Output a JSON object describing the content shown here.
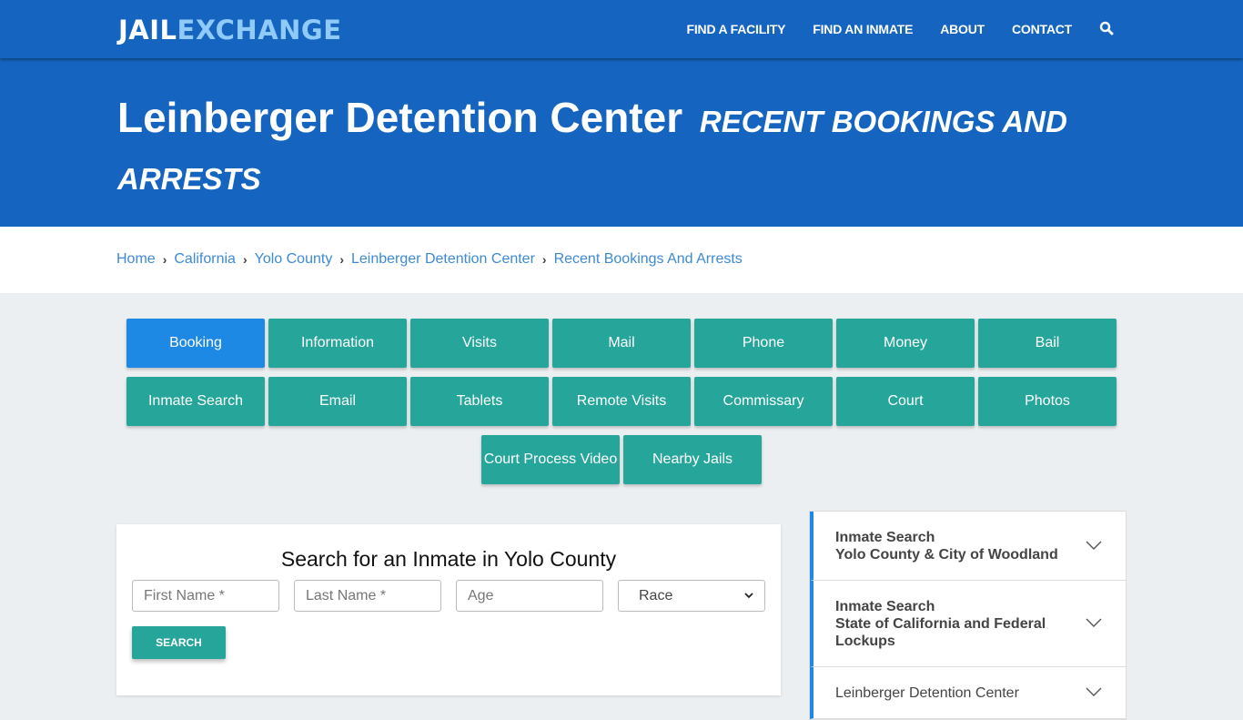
{
  "header": {
    "logo_part1": "JAIL",
    "logo_part2": "EXCHANGE",
    "nav": [
      "FIND A FACILITY",
      "FIND AN INMATE",
      "ABOUT",
      "CONTACT"
    ],
    "search_icon": "search-icon"
  },
  "hero": {
    "title": "Leinberger Detention Center",
    "subtitle": "Recent Bookings And Arrests"
  },
  "breadcrumb": [
    "Home",
    "California",
    "Yolo County",
    "Leinberger Detention Center",
    "Recent Bookings And Arrests"
  ],
  "tabs": {
    "active": "Booking",
    "items": [
      "Booking",
      "Information",
      "Visits",
      "Mail",
      "Phone",
      "Money",
      "Bail",
      "Inmate Search",
      "Email",
      "Tablets",
      "Remote Visits",
      "Commissary",
      "Court",
      "Photos",
      "Court Process Video",
      "Nearby Jails"
    ]
  },
  "search": {
    "title": "Search for an Inmate in Yolo County",
    "first_name_placeholder": "First Name *",
    "last_name_placeholder": "Last Name *",
    "age_placeholder": "Age",
    "race_selected": "Race",
    "button": "SEARCH"
  },
  "sidebar": {
    "items": [
      {
        "line1": "Inmate Search",
        "line2": "Yolo County & City of Woodland"
      },
      {
        "line1": "Inmate Search",
        "line2": "State of California and Federal Lockups"
      },
      {
        "line1": "Leinberger Detention Center",
        "line2": ""
      }
    ]
  },
  "colors": {
    "primary_blue": "#1565c0",
    "active_tab": "#1e88e5",
    "teal": "#26a69a",
    "link": "#3d8ad6"
  }
}
